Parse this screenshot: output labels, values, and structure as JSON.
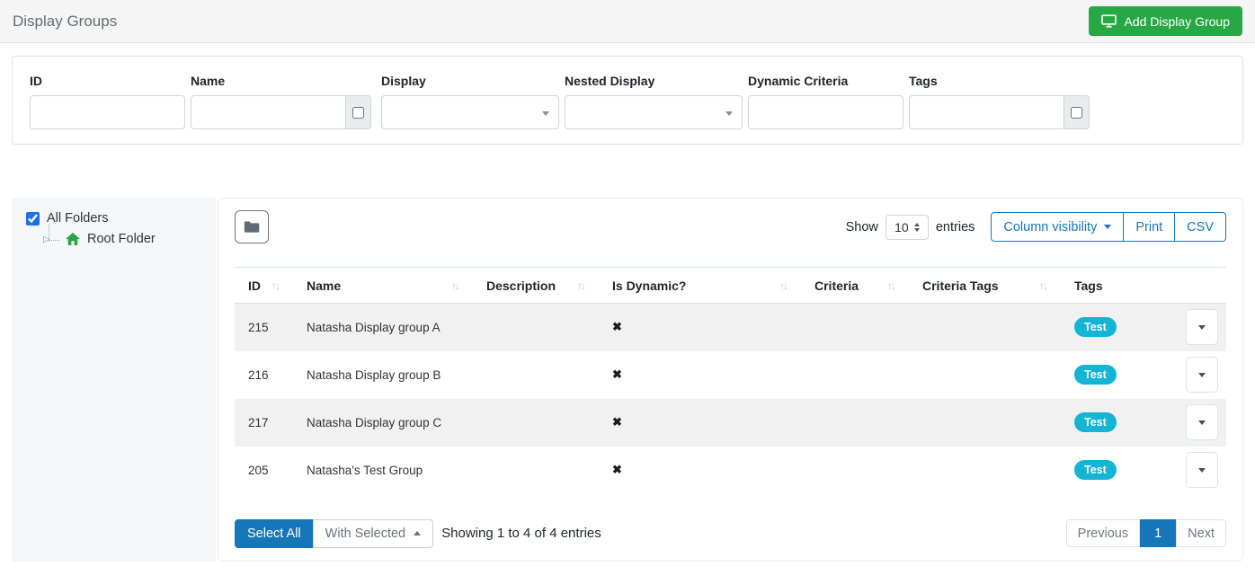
{
  "colors": {
    "accent": "#1577b8",
    "green": "#28a745",
    "cyan": "#14b4d4"
  },
  "header": {
    "title": "Display Groups",
    "add_button_label": "Add Display Group"
  },
  "filters": {
    "id": {
      "label": "ID",
      "value": ""
    },
    "name": {
      "label": "Name",
      "value": "",
      "checkbox_checked": false
    },
    "display": {
      "label": "Display",
      "selected": ""
    },
    "nested_display": {
      "label": "Nested Display",
      "selected": ""
    },
    "dynamic_criteria": {
      "label": "Dynamic Criteria",
      "value": ""
    },
    "tags": {
      "label": "Tags",
      "value": "",
      "checkbox_checked": false
    }
  },
  "sidebar": {
    "all_folders": {
      "label": "All Folders",
      "checked": true
    },
    "root_folder": {
      "label": "Root Folder"
    }
  },
  "toolbar": {
    "show_label": "Show",
    "page_size": "10",
    "entries_label": "entries",
    "column_visibility_label": "Column visibility",
    "print_label": "Print",
    "csv_label": "CSV"
  },
  "icons": {
    "add_button": "monitor-icon",
    "folder_toggle": "folder-icon",
    "root_folder": "home-icon",
    "sort": "sort-up-down-icon",
    "not_dynamic": "x-mark-icon",
    "row_actions": "chevron-down-icon"
  },
  "table": {
    "sort_glyph": "↑↓",
    "not_dynamic_glyph": "✖",
    "columns": [
      {
        "key": "id",
        "label": "ID",
        "sortable": true
      },
      {
        "key": "name",
        "label": "Name",
        "sortable": true
      },
      {
        "key": "description",
        "label": "Description",
        "sortable": true
      },
      {
        "key": "is_dynamic",
        "label": "Is Dynamic?",
        "sortable": true
      },
      {
        "key": "criteria",
        "label": "Criteria",
        "sortable": true
      },
      {
        "key": "criteria_tags",
        "label": "Criteria Tags",
        "sortable": true
      },
      {
        "key": "tags",
        "label": "Tags",
        "sortable": false
      },
      {
        "key": "actions",
        "label": "",
        "sortable": false
      }
    ],
    "rows": [
      {
        "id": "215",
        "name": "Natasha Display group A",
        "description": "",
        "is_dynamic": false,
        "criteria": "",
        "criteria_tags": "",
        "tags": [
          "Test"
        ]
      },
      {
        "id": "216",
        "name": "Natasha Display group B",
        "description": "",
        "is_dynamic": false,
        "criteria": "",
        "criteria_tags": "",
        "tags": [
          "Test"
        ]
      },
      {
        "id": "217",
        "name": "Natasha Display group C",
        "description": "",
        "is_dynamic": false,
        "criteria": "",
        "criteria_tags": "",
        "tags": [
          "Test"
        ]
      },
      {
        "id": "205",
        "name": "Natasha's Test Group",
        "description": "",
        "is_dynamic": false,
        "criteria": "",
        "criteria_tags": "",
        "tags": [
          "Test"
        ]
      }
    ]
  },
  "footer": {
    "select_all_label": "Select All",
    "with_selected_label": "With Selected",
    "showing_text": "Showing 1 to 4 of 4 entries"
  },
  "pagination": {
    "previous_label": "Previous",
    "pages": [
      "1"
    ],
    "active_page": "1",
    "next_label": "Next"
  }
}
